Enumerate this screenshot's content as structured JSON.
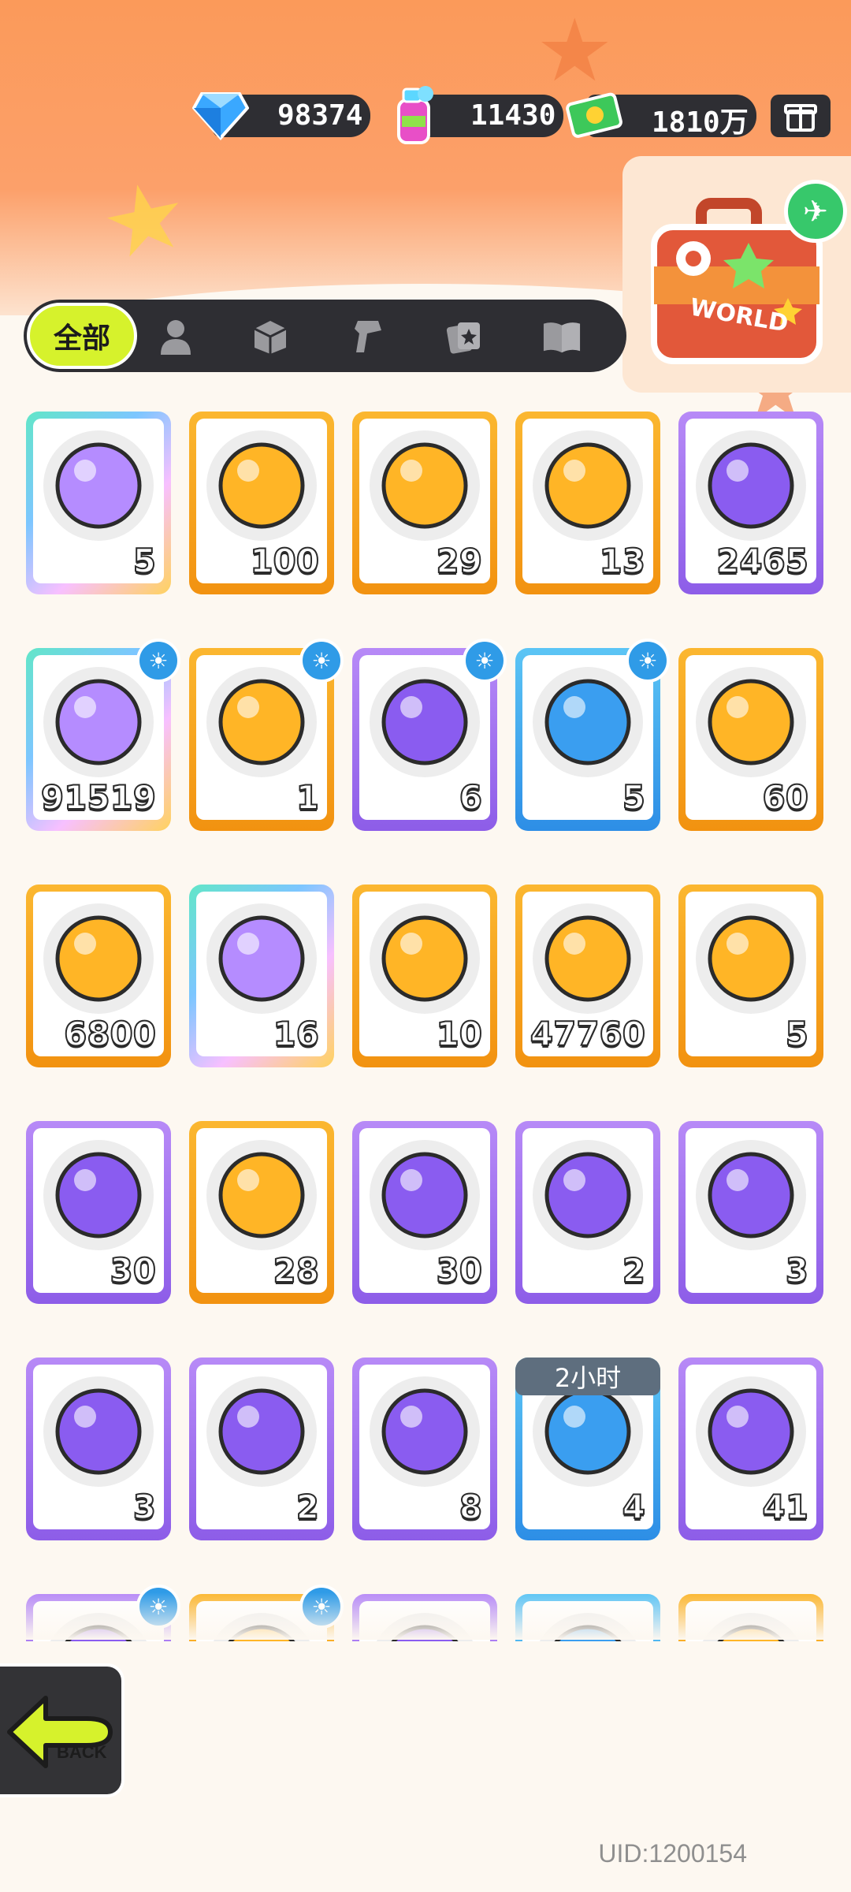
{
  "currency": {
    "gems": "98374",
    "spray": "11430",
    "cash": "1810万"
  },
  "world_badge": "WORLD",
  "tabs": {
    "all_label": "全部",
    "icons": [
      "person-icon",
      "box-icon",
      "spray-gun-icon",
      "cards-icon",
      "book-icon"
    ]
  },
  "items": [
    {
      "count": "5",
      "rarity": "rainbow",
      "icon": "crown-ticket-icon"
    },
    {
      "count": "100",
      "rarity": "orange",
      "icon": "gold-ticket-icon"
    },
    {
      "count": "29",
      "rarity": "orange",
      "icon": "purple-ticket-icon"
    },
    {
      "count": "13",
      "rarity": "orange",
      "icon": "rainbow-star-icon"
    },
    {
      "count": "2465",
      "rarity": "purple",
      "icon": "purple-star-icon"
    },
    {
      "count": "91519",
      "rarity": "rainbow",
      "icon": "rainbow-crayon-icon",
      "badge": true
    },
    {
      "count": "1",
      "rarity": "orange",
      "icon": "gold-crayon-icon",
      "badge": true
    },
    {
      "count": "6",
      "rarity": "purple",
      "icon": "purple-crayon-icon",
      "badge": true
    },
    {
      "count": "5",
      "rarity": "blue",
      "icon": "blue-crayon-icon",
      "badge": true
    },
    {
      "count": "60",
      "rarity": "orange",
      "icon": "color-cube-icon"
    },
    {
      "count": "6800",
      "rarity": "orange",
      "icon": "cool-badge-icon"
    },
    {
      "count": "16",
      "rarity": "rainbow",
      "icon": "lottery-ticket-icon"
    },
    {
      "count": "10",
      "rarity": "orange",
      "icon": "star-sticker-icon"
    },
    {
      "count": "47760",
      "rarity": "orange",
      "icon": "season-ticket-icon"
    },
    {
      "count": "5",
      "rarity": "orange",
      "icon": "mystery-orb-orange-icon"
    },
    {
      "count": "30",
      "rarity": "purple",
      "icon": "mystery-orb-purple-icon"
    },
    {
      "count": "28",
      "rarity": "orange",
      "icon": "mystery-deity-icon"
    },
    {
      "count": "30",
      "rarity": "purple",
      "icon": "mystery-travel-card-icon"
    },
    {
      "count": "2",
      "rarity": "purple",
      "icon": "bat-orb-icon"
    },
    {
      "count": "3",
      "rarity": "purple",
      "icon": "fish-orb-icon"
    },
    {
      "count": "3",
      "rarity": "purple",
      "icon": "piranha-orb-icon"
    },
    {
      "count": "2",
      "rarity": "purple",
      "icon": "yellow-creature-orb-icon"
    },
    {
      "count": "8",
      "rarity": "purple",
      "icon": "plant-orb-icon"
    },
    {
      "count": "4",
      "rarity": "blue",
      "icon": "alarm-clock-icon",
      "timer": "2小时"
    },
    {
      "count": "41",
      "rarity": "purple",
      "icon": "green-cup-icon"
    },
    {
      "count": "",
      "rarity": "purple",
      "icon": "partial-item-icon",
      "badge": true
    },
    {
      "count": "",
      "rarity": "orange",
      "icon": "partial-item-icon",
      "badge": true
    },
    {
      "count": "",
      "rarity": "purple",
      "icon": "partial-item-icon"
    },
    {
      "count": "",
      "rarity": "blue",
      "icon": "partial-item-icon"
    },
    {
      "count": "",
      "rarity": "orange",
      "icon": "partial-item-icon"
    }
  ],
  "back_label": "BACK",
  "uid": "UID:1200154"
}
